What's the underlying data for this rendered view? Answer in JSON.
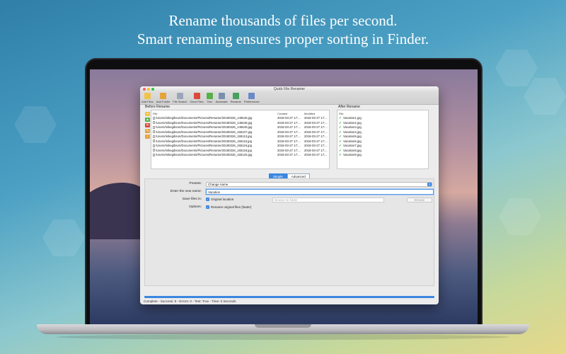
{
  "headline": {
    "line1": "Rename thousands of files per second.",
    "line2": "Smart renaming ensures proper sorting in Finder."
  },
  "window": {
    "title": "Quick File Renamer"
  },
  "toolbar": {
    "items": [
      {
        "label": "Add Files",
        "icon": "add-files-icon",
        "color": "#f2c24a"
      },
      {
        "label": "Add Folder",
        "icon": "add-folder-icon",
        "color": "#e5a43a"
      },
      {
        "label": "File Search",
        "icon": "file-search-icon",
        "color": "#9aa7b8"
      },
      {
        "label": "Clear Files",
        "icon": "clear-files-icon",
        "color": "#d84a3a"
      },
      {
        "label": "Test",
        "icon": "test-icon",
        "color": "#58b04a"
      },
      {
        "label": "Automate",
        "icon": "automate-icon",
        "color": "#7a8fb0"
      },
      {
        "label": "Rename",
        "icon": "rename-icon",
        "color": "#4aa060"
      },
      {
        "label": "Preferences",
        "icon": "preferences-icon",
        "color": "#6a89c8"
      }
    ]
  },
  "before": {
    "title": "Before Rename",
    "headers": {
      "file": "File",
      "created": "Created",
      "modified": "Modified"
    },
    "side_buttons": [
      {
        "icon": "add-icon",
        "symbol": "+",
        "color": "#f2c24a"
      },
      {
        "icon": "move-up-icon",
        "symbol": "▲",
        "color": "#58b04a"
      },
      {
        "icon": "remove-icon",
        "symbol": "✕",
        "color": "#d84a3a"
      },
      {
        "icon": "edit-icon",
        "symbol": "✎",
        "color": "#e5a43a"
      },
      {
        "icon": "sort-icon",
        "symbol": "↕",
        "color": "#e5a43a"
      }
    ],
    "rows": [
      {
        "file": "/Users/mikegibson/Documents/Pictures/Rename/20180326_145546.jpg",
        "created": "2018-03-27 17:...",
        "modified": "2018-03-27 17:..."
      },
      {
        "file": "/Users/mikegibson/Documents/Pictures/Rename/20180326_145548.jpg",
        "created": "2018-03-27 17:...",
        "modified": "2018-03-27 17:..."
      },
      {
        "file": "/Users/mikegibson/Documents/Pictures/Rename/20180326_145549.jpg",
        "created": "2018-03-27 17:...",
        "modified": "2018-03-27 17:..."
      },
      {
        "file": "/Users/mikegibson/Documents/Pictures/Rename/20180326_155107.jpg",
        "created": "2018-03-27 17:...",
        "modified": "2018-03-27 17:..."
      },
      {
        "file": "/Users/mikegibson/Documents/Pictures/Rename/20180326_155113.jpg",
        "created": "2018-03-27 17:...",
        "modified": "2018-03-27 17:..."
      },
      {
        "file": "/Users/mikegibson/Documents/Pictures/Rename/20180326_155115.jpg",
        "created": "2018-03-27 17:...",
        "modified": "2018-03-27 17:..."
      },
      {
        "file": "/Users/mikegibson/Documents/Pictures/Rename/20180326_155116.jpg",
        "created": "2018-03-27 17:...",
        "modified": "2018-03-27 17:..."
      },
      {
        "file": "/Users/mikegibson/Documents/Pictures/Rename/20180326_155118.jpg",
        "created": "2018-03-27 17:...",
        "modified": "2018-03-27 17:..."
      },
      {
        "file": "/Users/mikegibson/Documents/Pictures/Rename/20180326_155126.jpg",
        "created": "2018-03-27 17:...",
        "modified": "2018-03-27 17:..."
      }
    ]
  },
  "after": {
    "title": "After Rename",
    "header": "File",
    "rows": [
      "Vacation1.jpg",
      "Vacation2.jpg",
      "Vacation3.jpg",
      "Vacation4.jpg",
      "Vacation5.jpg",
      "Vacation6.jpg",
      "Vacation7.jpg",
      "Vacation8.jpg",
      "Vacation9.jpg"
    ]
  },
  "tabs": {
    "simple": "Simple",
    "advanced": "Advanced"
  },
  "form": {
    "presets_label": "Presets:",
    "presets_value": "Change name",
    "new_name_label": "Enter the new name:",
    "new_name_value": "Vacation",
    "save_label": "Save files in:",
    "save_checkbox": "Original location",
    "browse_placeholder": "Browse for folder",
    "browse_button": "Browse",
    "options_label": "Options:",
    "options_checkbox": "Rename original files (faster)"
  },
  "progress": {
    "fraction": 1.0
  },
  "status": "Complete - Success: 9 - Errors: 0 - Test: True - Time: 0 Seconds"
}
